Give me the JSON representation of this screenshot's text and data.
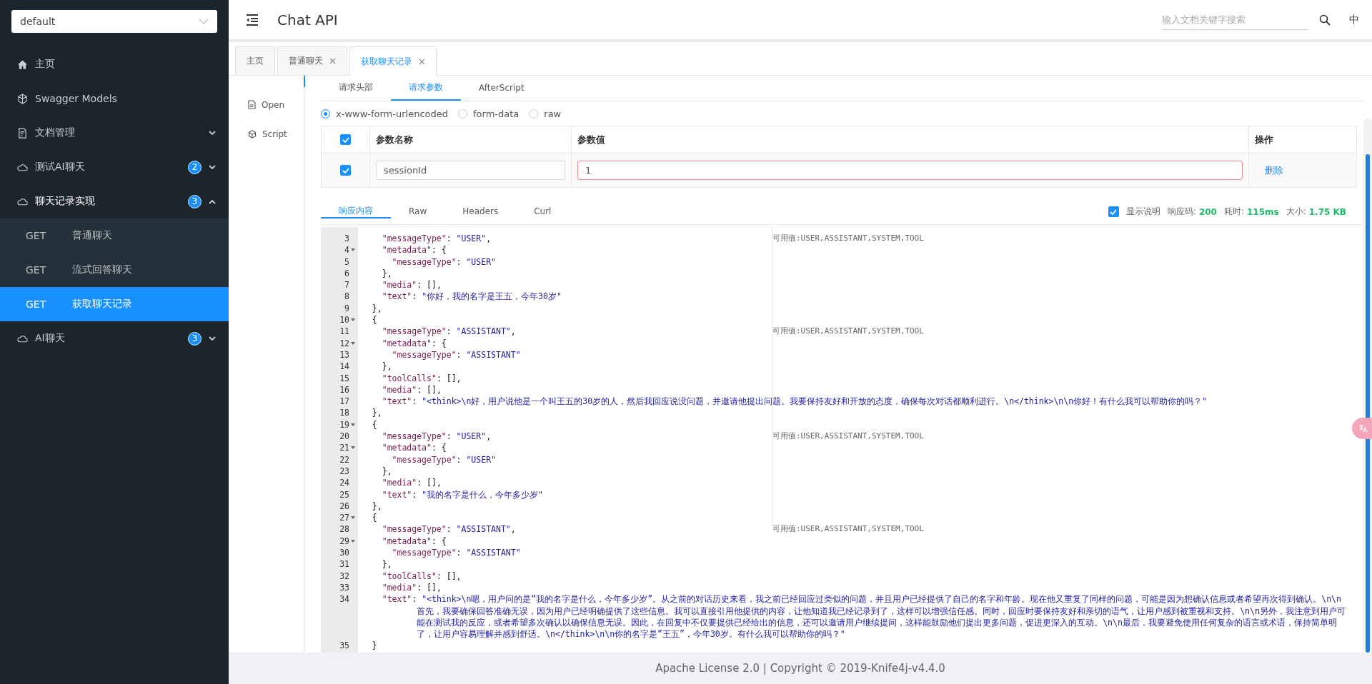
{
  "sidebar": {
    "group_select": "default",
    "items": [
      {
        "label": "主页",
        "kind": "home"
      },
      {
        "label": "Swagger Models",
        "kind": "models"
      },
      {
        "label": "文档管理",
        "kind": "docs",
        "expanded": false
      },
      {
        "label": "测试AI聊天",
        "kind": "cloud",
        "badge": "2",
        "expanded": false
      },
      {
        "label": "聊天记录实现",
        "kind": "cloud",
        "badge": "3",
        "expanded": true,
        "children": [
          {
            "method": "GET",
            "label": "普通聊天",
            "selected": false
          },
          {
            "method": "GET",
            "label": "流式回答聊天",
            "selected": false
          },
          {
            "method": "GET",
            "label": "获取聊天记录",
            "selected": true
          }
        ]
      },
      {
        "label": "AI聊天",
        "kind": "cloud",
        "badge": "3",
        "expanded": false
      }
    ]
  },
  "header": {
    "title": "Chat API",
    "search": {
      "placeholder": "输入文档关键字搜索"
    },
    "language": "中"
  },
  "page_tabs": [
    {
      "label": "主页",
      "selected": false,
      "closable": false
    },
    {
      "label": "普通聊天",
      "selected": false,
      "closable": true
    },
    {
      "label": "获取聊天记录",
      "selected": true,
      "closable": true
    }
  ],
  "side_nav": [
    {
      "label": "Open",
      "kind": "doc"
    },
    {
      "label": "Script",
      "kind": "script"
    }
  ],
  "request_tabs": [
    {
      "label": "请求头部",
      "selected": false
    },
    {
      "label": "请求参数",
      "selected": true
    },
    {
      "label": "AfterScript",
      "selected": false
    }
  ],
  "body_types": [
    {
      "label": "x-www-form-urlencoded",
      "selected": true
    },
    {
      "label": "form-data",
      "selected": false
    },
    {
      "label": "raw",
      "selected": false
    }
  ],
  "params_table": {
    "columns": [
      "参数名称",
      "参数值",
      "操作"
    ],
    "all_checked": true,
    "rows": [
      {
        "checked": true,
        "name": "sessionId",
        "value": "1",
        "invalid": true,
        "action": "删除"
      }
    ]
  },
  "response_tabs": [
    {
      "label": "响应内容",
      "selected": true
    },
    {
      "label": "Raw",
      "selected": false
    },
    {
      "label": "Headers",
      "selected": false
    },
    {
      "label": "Curl",
      "selected": false
    }
  ],
  "response_status": {
    "show_description": true,
    "show_description_label": "显示说明",
    "code_label": "响应码:",
    "code": "200",
    "time_label": "耗时:",
    "time": "115ms",
    "size_label": "大小:",
    "size": "1.75 KB"
  },
  "code_lines": [
    {
      "number": "3",
      "fold": false,
      "code": "    \"messageType\": \"USER\",",
      "note": "可用值:USER,ASSISTANT,SYSTEM,TOOL"
    },
    {
      "number": "4",
      "fold": true,
      "code": "    \"metadata\": {"
    },
    {
      "number": "5",
      "fold": false,
      "code": "      \"messageType\": \"USER\""
    },
    {
      "number": "6",
      "fold": false,
      "code": "    },"
    },
    {
      "number": "7",
      "fold": false,
      "code": "    \"media\": [],"
    },
    {
      "number": "8",
      "fold": false,
      "code": "    \"text\": \"你好，我的名字是王五，今年30岁\""
    },
    {
      "number": "9",
      "fold": false,
      "code": "  },"
    },
    {
      "number": "10",
      "fold": true,
      "code": "  {"
    },
    {
      "number": "11",
      "fold": false,
      "code": "    \"messageType\": \"ASSISTANT\",",
      "note": "可用值:USER,ASSISTANT,SYSTEM,TOOL"
    },
    {
      "number": "12",
      "fold": true,
      "code": "    \"metadata\": {"
    },
    {
      "number": "13",
      "fold": false,
      "code": "      \"messageType\": \"ASSISTANT\""
    },
    {
      "number": "14",
      "fold": false,
      "code": "    },"
    },
    {
      "number": "15",
      "fold": false,
      "code": "    \"toolCalls\": [],"
    },
    {
      "number": "16",
      "fold": false,
      "code": "    \"media\": [],"
    },
    {
      "number": "17",
      "fold": false,
      "code": "    \"text\": \"<think>\\n好，用户说他是一个叫王五的30岁的人，然后我回应说没问题，并邀请他提出问题。我要保持友好和开放的态度，确保每次对话都顺利进行。\\n</think>\\n\\n你好！有什么我可以帮助你的吗？\""
    },
    {
      "number": "18",
      "fold": false,
      "code": "  },"
    },
    {
      "number": "19",
      "fold": true,
      "code": "  {"
    },
    {
      "number": "20",
      "fold": false,
      "code": "    \"messageType\": \"USER\",",
      "note": "可用值:USER,ASSISTANT,SYSTEM,TOOL"
    },
    {
      "number": "21",
      "fold": true,
      "code": "    \"metadata\": {"
    },
    {
      "number": "22",
      "fold": false,
      "code": "      \"messageType\": \"USER\""
    },
    {
      "number": "23",
      "fold": false,
      "code": "    },"
    },
    {
      "number": "24",
      "fold": false,
      "code": "    \"media\": [],"
    },
    {
      "number": "25",
      "fold": false,
      "code": "    \"text\": \"我的名字是什么，今年多少岁\""
    },
    {
      "number": "26",
      "fold": false,
      "code": "  },"
    },
    {
      "number": "27",
      "fold": true,
      "code": "  {"
    },
    {
      "number": "28",
      "fold": false,
      "code": "    \"messageType\": \"ASSISTANT\",",
      "note": "可用值:USER,ASSISTANT,SYSTEM,TOOL"
    },
    {
      "number": "29",
      "fold": true,
      "code": "    \"metadata\": {"
    },
    {
      "number": "30",
      "fold": false,
      "code": "      \"messageType\": \"ASSISTANT\""
    },
    {
      "number": "31",
      "fold": false,
      "code": "    },"
    },
    {
      "number": "32",
      "fold": false,
      "code": "    \"toolCalls\": [],"
    },
    {
      "number": "33",
      "fold": false,
      "code": "    \"media\": [],"
    },
    {
      "number": "34",
      "fold": false,
      "code": "    \"text\": \"<think>\\n嗯，用户问的是“我的名字是什么，今年多少岁”。从之前的对话历史来看，我之前已经回应过类似的问题，并且用户已经提供了自己的名字和年龄。现在他又重复了同样的问题，可能是因为想确认信息或者希望再次得到确认。\\n\\n首先，我要确保回答准确无误，因为用户已经明确提供了这些信息。我可以直接引用他提供的内容，让他知道我已经记录到了，这样可以增强信任感。同时，回应时要保持友好和亲切的语气，让用户感到被重视和支持。\\n\\n另外，我注意到用户可能在测试我的反应，或者希望多次确认以确保信息无误。因此，在回复中不仅要提供已经给出的信息，还可以邀请用户继续提问，这样能鼓励他们提出更多问题，促进更深入的互动。\\n\\n最后，我要避免使用任何复杂的语言或术语，保持简单明了，让用户容易理解并感到舒适。\\n</think>\\n\\n你的名字是“王五”，今年30岁。有什么我可以帮助你的吗？\""
    },
    {
      "number": "35",
      "fold": false,
      "code": "  }"
    }
  ],
  "footer": "Apache License 2.0 | Copyright © 2019-Knife4j-v4.4.0"
}
